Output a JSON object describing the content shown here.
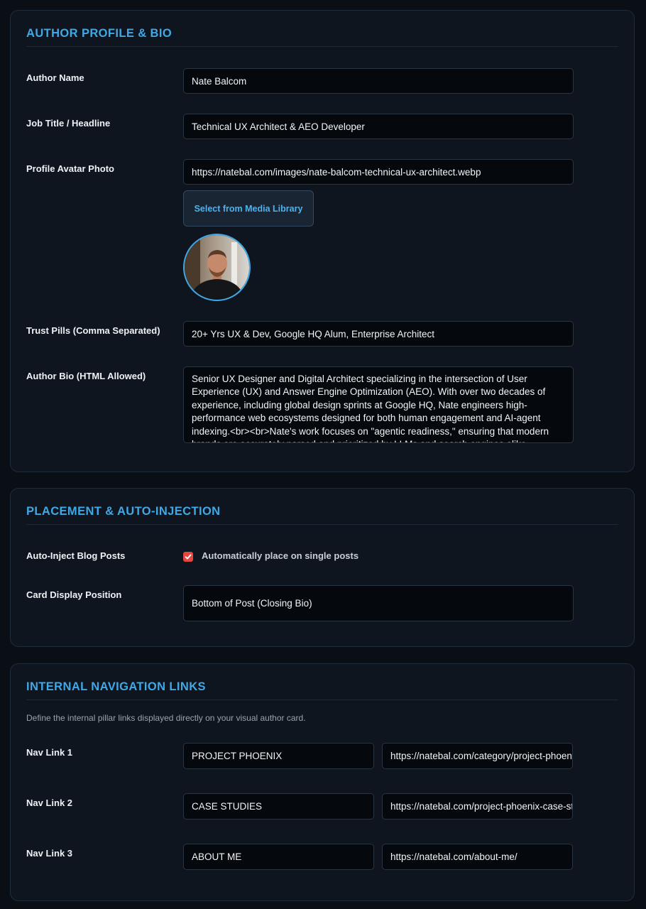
{
  "author_section": {
    "title": "AUTHOR PROFILE & BIO",
    "name_label": "Author Name",
    "name_value": "Nate Balcom",
    "job_label": "Job Title / Headline",
    "job_value": "Technical UX Architect & AEO Developer",
    "avatar_label": "Profile Avatar Photo",
    "avatar_value": "https://natebal.com/images/nate-balcom-technical-ux-architect.webp",
    "media_button": "Select from Media Library",
    "pills_label": "Trust Pills (Comma Separated)",
    "pills_value": "20+ Yrs UX & Dev, Google HQ Alum, Enterprise Architect",
    "bio_label": "Author Bio (HTML Allowed)",
    "bio_value": "Senior UX Designer and Digital Architect specializing in the intersection of User Experience (UX) and Answer Engine Optimization (AEO). With over two decades of experience, including global design sprints at Google HQ, Nate engineers high-performance web ecosystems designed for both human engagement and AI-agent indexing.<br><br>Nate's work focuses on \"agentic readiness,\" ensuring that modern brands are accurately parsed and prioritized by LLMs and search engines alike."
  },
  "placement_section": {
    "title": "PLACEMENT & AUTO-INJECTION",
    "auto_inject_label": "Auto-Inject Blog Posts",
    "auto_inject_checkbox_label": "Automatically place on single posts",
    "auto_inject_checked": true,
    "position_label": "Card Display Position",
    "position_value": "Bottom of Post (Closing Bio)"
  },
  "nav_section": {
    "title": "INTERNAL NAVIGATION LINKS",
    "description": "Define the internal pillar links displayed directly on your visual author card.",
    "links": [
      {
        "label": "Nav Link 1",
        "text": "PROJECT PHOENIX",
        "url": "https://natebal.com/category/project-phoenix/"
      },
      {
        "label": "Nav Link 2",
        "text": "CASE STUDIES",
        "url": "https://natebal.com/project-phoenix-case-studies/"
      },
      {
        "label": "Nav Link 3",
        "text": "ABOUT ME",
        "url": "https://natebal.com/about-me/"
      }
    ]
  },
  "colors": {
    "accent": "#3fa9e8",
    "background": "#0a0f16",
    "card": "#0f151e",
    "checkbox": "#e5463f"
  }
}
